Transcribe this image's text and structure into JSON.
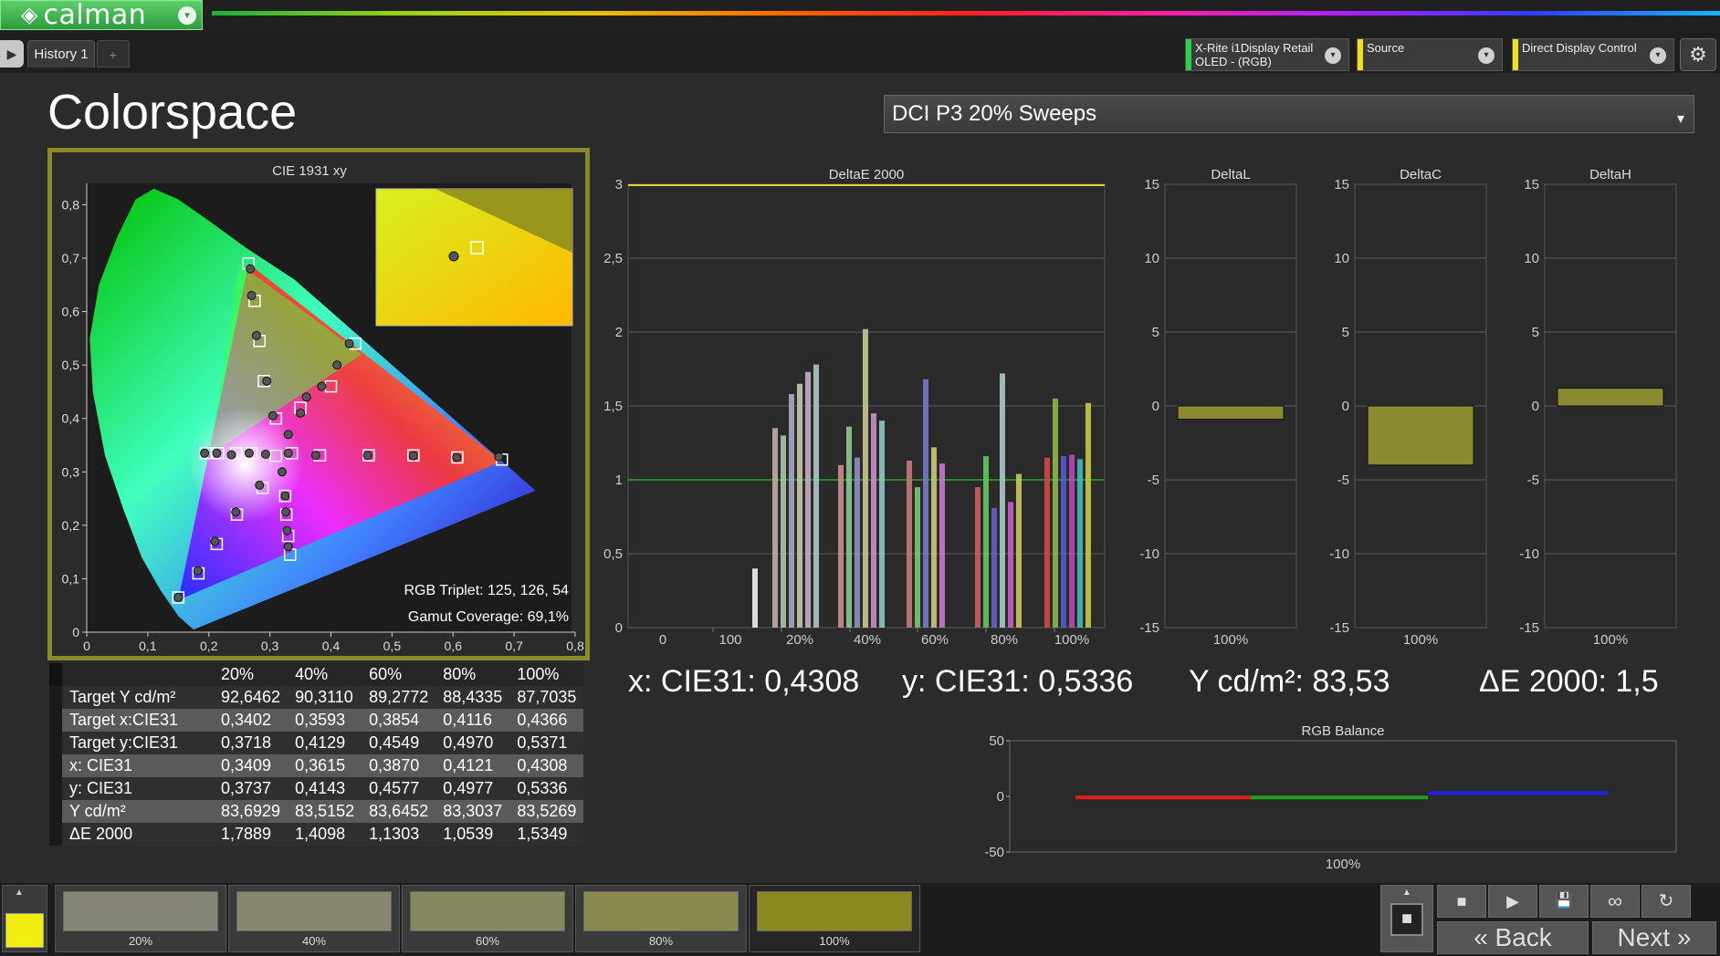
{
  "app": {
    "logo_text": "calman",
    "logo_mark": "◈",
    "dropdown_icon": "▾"
  },
  "tabs": {
    "toggle_icon": "▶",
    "history_label": "History 1",
    "add_icon": "+"
  },
  "devices": {
    "meter": {
      "line1": "X-Rite i1Display Retail",
      "line2": "OLED - (RGB)",
      "color": "#2bd14a"
    },
    "source": {
      "line1": "Source",
      "line2": "",
      "color": "#f0e020"
    },
    "display": {
      "line1": "Direct Display Control",
      "line2": "",
      "color": "#f0e020"
    },
    "dropdown_icon": "▾",
    "settings_icon": "⚙"
  },
  "page": {
    "title": "Colorspace",
    "workflow": "DCI P3 20% Sweeps",
    "workflow_icon": "▾"
  },
  "cie": {
    "title": "CIE 1931 xy",
    "x_ticks": [
      "0",
      "0,1",
      "0,2",
      "0,3",
      "0,4",
      "0,5",
      "0,6",
      "0,7",
      "0,8"
    ],
    "y_ticks": [
      "0",
      "0,1",
      "0,2",
      "0,3",
      "0,4",
      "0,5",
      "0,6",
      "0,7",
      "0,8"
    ],
    "rgb_triplet": "RGB Triplet: 125, 126, 54",
    "gamut_coverage": "Gamut Coverage: 69,1%"
  },
  "chart_data": [
    {
      "type": "bar",
      "title": "DeltaE 2000",
      "ylim": [
        0,
        3
      ],
      "y_ticks": [
        "0",
        "0,5",
        "1",
        "1,5",
        "2",
        "2,5",
        "3"
      ],
      "x_ticks": [
        "0",
        "100",
        "20%",
        "40%",
        "60%",
        "80%",
        "100%"
      ],
      "threshold": 1,
      "groups": [
        {
          "name": "white",
          "values": [
            0.4
          ],
          "colors": [
            "#f0f0f0"
          ]
        },
        {
          "name": "20%",
          "values": [
            1.35,
            1.3,
            1.58,
            1.65,
            1.73,
            1.78
          ],
          "colors": [
            "#c8a8a8",
            "#a8c8a8",
            "#a8a8c8",
            "#c8c8a8",
            "#c8a8c8",
            "#a8c8c8"
          ]
        },
        {
          "name": "40%",
          "values": [
            1.1,
            1.36,
            1.15,
            2.02,
            1.45,
            1.4
          ],
          "colors": [
            "#c89090",
            "#90c890",
            "#9090c8",
            "#c8c890",
            "#c890c8",
            "#90c8c8"
          ]
        },
        {
          "name": "60%",
          "values": [
            1.13,
            0.95,
            1.68,
            1.22,
            1.11
          ],
          "colors": [
            "#c87878",
            "#78c878",
            "#7878c8",
            "#c8c878",
            "#c878c8"
          ]
        },
        {
          "name": "80%",
          "values": [
            0.95,
            1.16,
            0.81,
            1.72,
            0.85,
            1.04
          ],
          "colors": [
            "#c86060",
            "#60c860",
            "#6060c8",
            "#a8c8c8",
            "#c860c8",
            "#c8c860"
          ]
        },
        {
          "name": "100%",
          "values": [
            1.15,
            1.55,
            1.16,
            1.17,
            1.14,
            1.52
          ],
          "colors": [
            "#d04848",
            "#88b848",
            "#5858d0",
            "#b848b8",
            "#48b8b8",
            "#c8c848"
          ]
        }
      ]
    },
    {
      "type": "bar",
      "title": "DeltaL",
      "ylim": [
        -15,
        15
      ],
      "y_ticks": [
        "15",
        "10",
        "5",
        "0",
        "-5",
        "-10",
        "-15"
      ],
      "categories": [
        "100%"
      ],
      "values": [
        -0.9
      ]
    },
    {
      "type": "bar",
      "title": "DeltaC",
      "ylim": [
        -15,
        15
      ],
      "y_ticks": [
        "15",
        "10",
        "5",
        "0",
        "-5",
        "-10",
        "-15"
      ],
      "categories": [
        "100%"
      ],
      "values": [
        -4.0
      ]
    },
    {
      "type": "bar",
      "title": "DeltaH",
      "ylim": [
        -15,
        15
      ],
      "y_ticks": [
        "15",
        "10",
        "5",
        "0",
        "-5",
        "-10",
        "-15"
      ],
      "categories": [
        "100%"
      ],
      "values": [
        1.2
      ]
    },
    {
      "type": "line",
      "title": "RGB Balance",
      "ylim": [
        -50,
        50
      ],
      "y_ticks": [
        "50",
        "0",
        "-50"
      ],
      "x_label": "100%",
      "series": [
        {
          "color": "#e02020",
          "values": [
            -1
          ]
        },
        {
          "color": "#20a020",
          "values": [
            -1
          ]
        },
        {
          "color": "#2020e0",
          "values": [
            3
          ]
        }
      ]
    }
  ],
  "readouts": {
    "x": "x: CIE31: 0,4308",
    "y": "y: CIE31: 0,5336",
    "Y": "Y cd/m²: 83,53",
    "de": "ΔE 2000: 1,5"
  },
  "table": {
    "headers": [
      "",
      "20%",
      "40%",
      "60%",
      "80%",
      "100%"
    ],
    "rows": [
      [
        "Target Y cd/m²",
        "92,6462",
        "90,3110",
        "89,2772",
        "88,4335",
        "87,7035"
      ],
      [
        "Target x:CIE31",
        "0,3402",
        "0,3593",
        "0,3854",
        "0,4116",
        "0,4366"
      ],
      [
        "Target y:CIE31",
        "0,3718",
        "0,4129",
        "0,4549",
        "0,4970",
        "0,5371"
      ],
      [
        "x: CIE31",
        "0,3409",
        "0,3615",
        "0,3870",
        "0,4121",
        "0,4308"
      ],
      [
        "y: CIE31",
        "0,3737",
        "0,4143",
        "0,4577",
        "0,4977",
        "0,5336"
      ],
      [
        "Y cd/m²",
        "83,6929",
        "83,5152",
        "83,6452",
        "83,3037",
        "83,5269"
      ],
      [
        "ΔE 2000",
        "1,7889",
        "1,4098",
        "1,1303",
        "1,0539",
        "1,5349"
      ]
    ]
  },
  "swatches": [
    {
      "label": "20%",
      "color": "#868678"
    },
    {
      "label": "40%",
      "color": "#88886f"
    },
    {
      "label": "60%",
      "color": "#878760"
    },
    {
      "label": "80%",
      "color": "#898950"
    },
    {
      "label": "100%",
      "color": "#8a8a20"
    }
  ],
  "controls": {
    "current_color": "#f2ee10",
    "up_icon": "▲",
    "stop_icon": "■",
    "play_icon": "▶",
    "save_icon": "💾",
    "loop_icon": "∞",
    "refresh_icon": "↻",
    "back_label": "Back",
    "back_icon": "«",
    "next_label": "Next",
    "next_icon": "»"
  }
}
